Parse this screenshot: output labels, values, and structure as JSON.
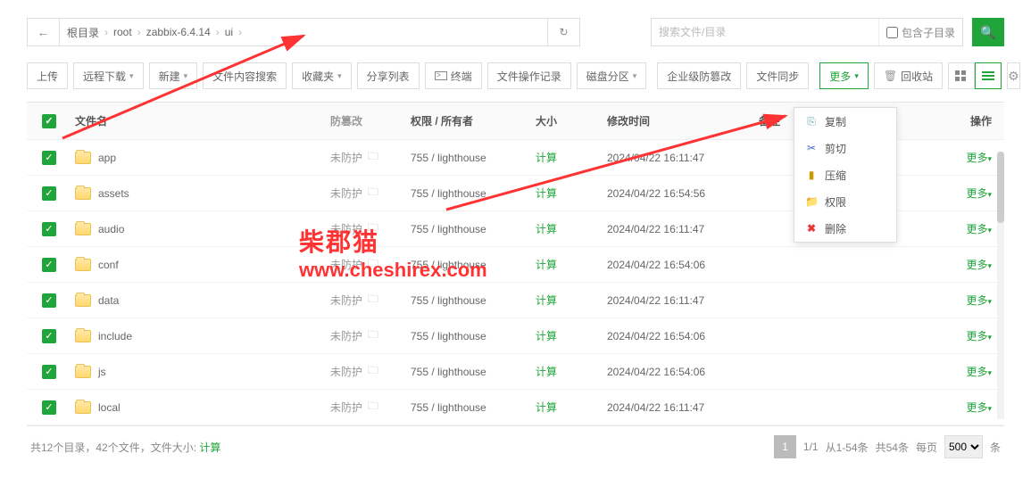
{
  "breadcrumb": {
    "root": "根目录",
    "parts": [
      "root",
      "zabbix-6.4.14",
      "ui"
    ]
  },
  "search": {
    "placeholder": "搜索文件/目录",
    "include_sub_label": "包含子目录"
  },
  "toolbar": {
    "upload": "上传",
    "remote_dl": "远程下载",
    "new": "新建",
    "content_search": "文件内容搜索",
    "favorites": "收藏夹",
    "share_list": "分享列表",
    "terminal": "终端",
    "op_log": "文件操作记录",
    "disk_part": "磁盘分区",
    "enterprise_tamper": "企业级防篡改",
    "file_sync": "文件同步",
    "more": "更多",
    "recycle": "回收站"
  },
  "columns": {
    "name": "文件名",
    "tamper": "防篡改",
    "perm": "权限 / 所有者",
    "size": "大小",
    "mtime": "修改时间",
    "note": "备注",
    "op": "操作"
  },
  "dropdown": {
    "copy": "复制",
    "cut": "剪切",
    "compress": "压缩",
    "perm": "权限",
    "delete": "删除"
  },
  "tamper_text": "未防护",
  "perm_text": "755 / lighthouse",
  "size_text": "计算",
  "row_more": "更多",
  "rows": [
    {
      "name": "app",
      "mtime": "2024/04/22 16:11:47"
    },
    {
      "name": "assets",
      "mtime": "2024/04/22 16:54:56"
    },
    {
      "name": "audio",
      "mtime": "2024/04/22 16:11:47"
    },
    {
      "name": "conf",
      "mtime": "2024/04/22 16:54:06"
    },
    {
      "name": "data",
      "mtime": "2024/04/22 16:11:47"
    },
    {
      "name": "include",
      "mtime": "2024/04/22 16:54:06"
    },
    {
      "name": "js",
      "mtime": "2024/04/22 16:54:06"
    },
    {
      "name": "local",
      "mtime": "2024/04/22 16:11:47"
    }
  ],
  "footer": {
    "summary_a": "共12个目录，42个文件，文件大小: ",
    "summary_b": "计算",
    "page": "1",
    "page_of": "1/1",
    "range": "从1-54条",
    "total": "共54条",
    "per_page_label_a": "每页",
    "per_page_val": "500",
    "per_page_label_b": "条"
  },
  "watermark": {
    "title": "柴郡猫",
    "url": "www.cheshirex.com"
  }
}
